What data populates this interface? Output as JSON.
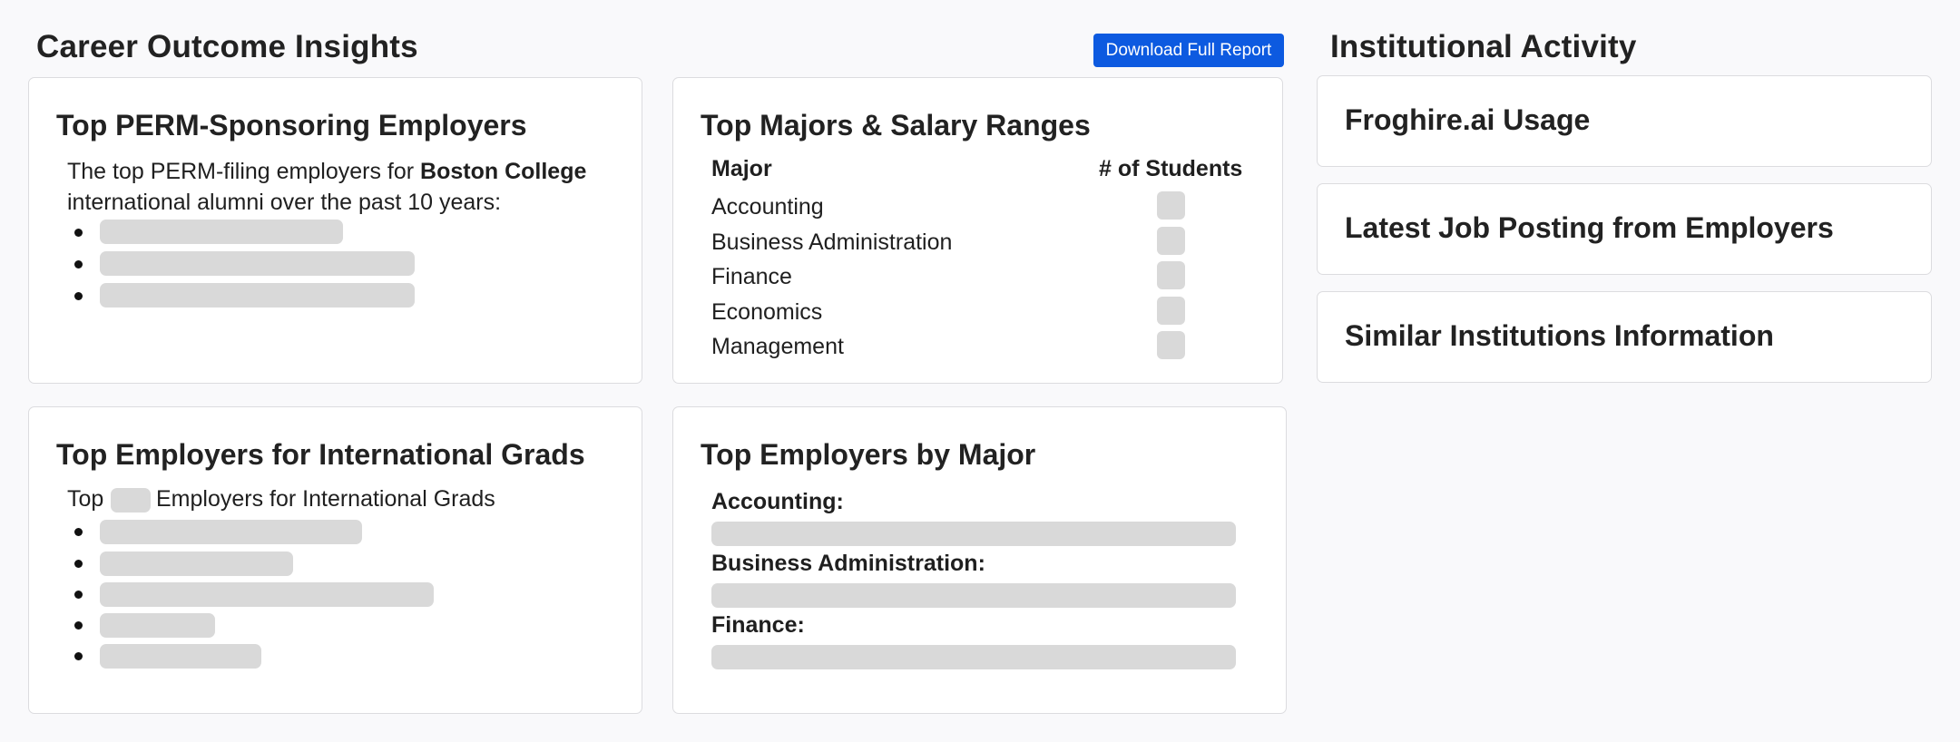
{
  "career": {
    "title": "Career Outcome Insights",
    "download_label": "Download Full Report"
  },
  "perm_card": {
    "title": "Top PERM-Sponsoring Employers",
    "intro_prefix": "The top PERM-filing employers for",
    "institution": "Boston College",
    "intro_suffix": "international alumni over the past 10 years:"
  },
  "majors_card": {
    "title": "Top Majors & Salary Ranges",
    "col_major": "Major",
    "col_students": "# of Students",
    "rows": [
      "Accounting",
      "Business Administration",
      "Finance",
      "Economics",
      "Management"
    ]
  },
  "intl_card": {
    "title": "Top Employers for International Grads",
    "text_prefix": "Top",
    "text_suffix": "Employers for International Grads"
  },
  "bymajor_card": {
    "title": "Top Employers by Major",
    "majors": [
      "Accounting:",
      "Business Administration:",
      "Finance:"
    ]
  },
  "institutional": {
    "title": "Institutional Activity",
    "items": [
      "Froghire.ai Usage",
      "Latest Job Posting from Employers",
      "Similar Institutions Information"
    ]
  }
}
